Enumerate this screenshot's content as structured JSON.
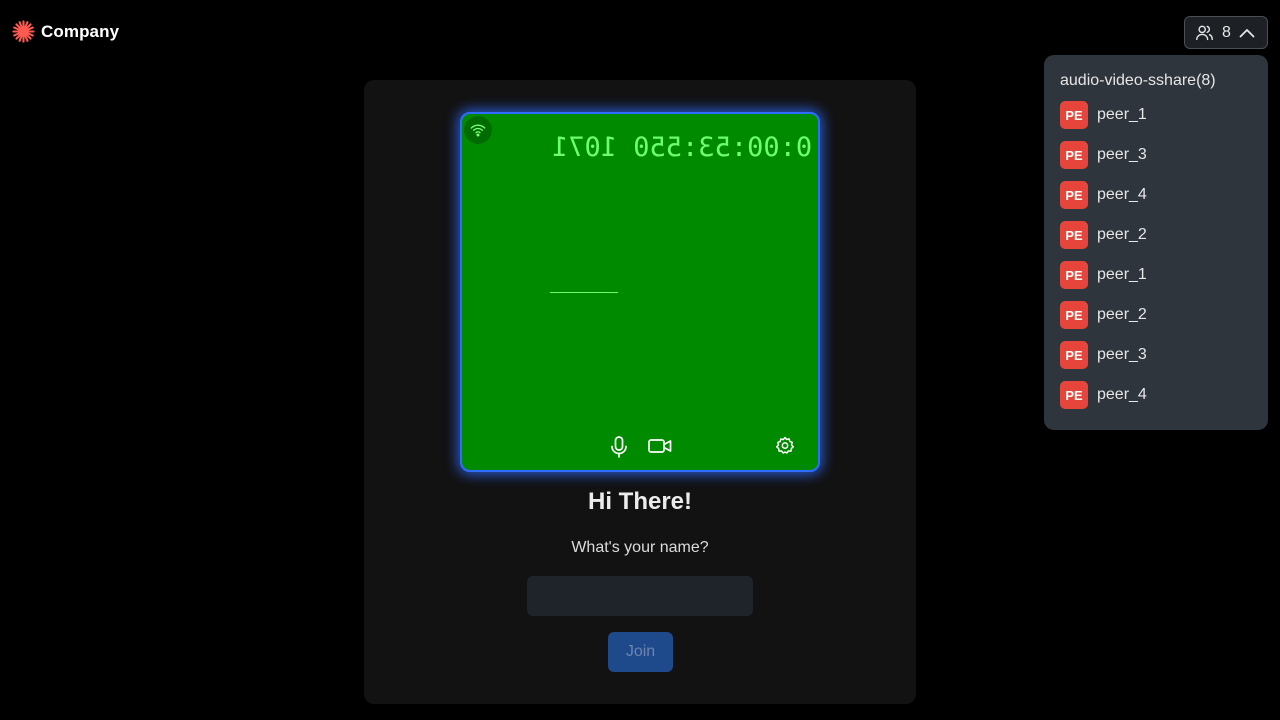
{
  "brand": {
    "name": "Company",
    "accent": "#e5453a"
  },
  "participants": {
    "count": "8",
    "room_title": "audio-video-sshare(8)",
    "avatar_color": "#e5453a",
    "peers": [
      {
        "initials": "PE",
        "name": "peer_1"
      },
      {
        "initials": "PE",
        "name": "peer_3"
      },
      {
        "initials": "PE",
        "name": "peer_4"
      },
      {
        "initials": "PE",
        "name": "peer_2"
      },
      {
        "initials": "PE",
        "name": "peer_1"
      },
      {
        "initials": "PE",
        "name": "peer_2"
      },
      {
        "initials": "PE",
        "name": "peer_3"
      },
      {
        "initials": "PE",
        "name": "peer_4"
      }
    ]
  },
  "preview": {
    "timer": "0:00:53:550 1071",
    "video_color": "#008a00",
    "border_color": "#2f6cff",
    "icons": [
      "network-icon",
      "microphone-icon",
      "video-camera-icon",
      "settings-icon"
    ]
  },
  "join": {
    "title": "Hi There!",
    "prompt": "What's your name?",
    "name_value": "",
    "button_label": "Join"
  }
}
